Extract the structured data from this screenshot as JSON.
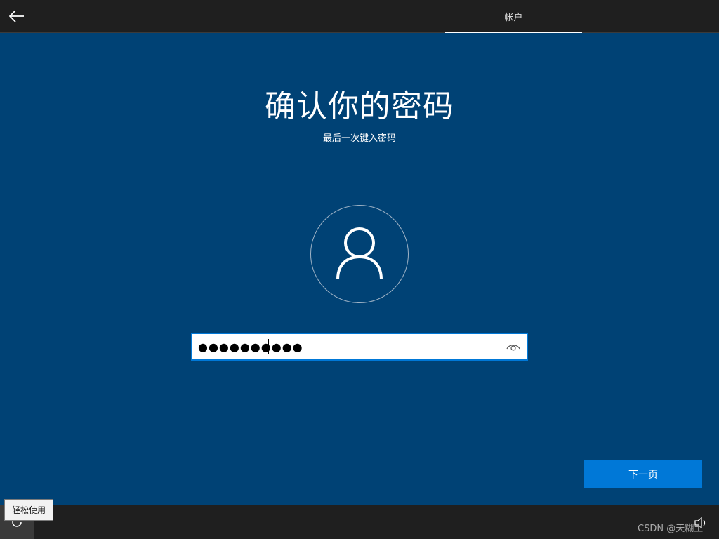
{
  "header": {
    "back_icon": "arrow-left-icon",
    "active_tab": "帐户"
  },
  "main": {
    "title": "确认你的密码",
    "subtitle": "最后一次键入密码",
    "avatar_icon": "user-icon",
    "password_field": {
      "value": "●●●●●●●●●●",
      "reveal_icon": "eye-icon"
    },
    "next_button": "下一页"
  },
  "footer": {
    "accessibility_icon": "accessibility-icon",
    "accessibility_tooltip": "轻松使用",
    "volume_icon": "volume-icon",
    "watermark": "CSDN @天糊土"
  },
  "colors": {
    "background": "#004275",
    "bar": "#1f1f1f",
    "accent": "#0078d7"
  }
}
